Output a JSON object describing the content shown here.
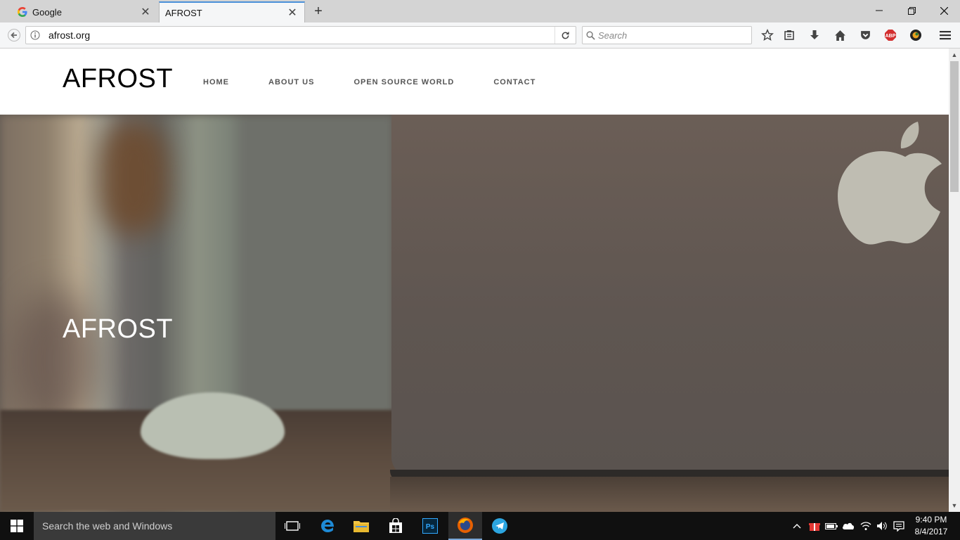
{
  "browser": {
    "tabs": [
      {
        "title": "Google",
        "active": false
      },
      {
        "title": "AFROST",
        "active": true
      }
    ],
    "url": "afrost.org",
    "search_placeholder": "Search",
    "accent_color": "#4a90d9"
  },
  "site": {
    "logo": "AFROST",
    "menu": [
      "HOME",
      "ABOUT US",
      "OPEN SOURCE WORLD",
      "CONTACT"
    ],
    "hero_title": "AFROST"
  },
  "taskbar": {
    "search_text": "Search the web and Windows",
    "apps": [
      "task-view-icon",
      "edge-icon",
      "file-explorer-icon",
      "store-icon",
      "photoshop-icon",
      "firefox-icon",
      "telegram-icon"
    ],
    "clock_time": "9:40 PM",
    "clock_date": "8/4/2017"
  }
}
